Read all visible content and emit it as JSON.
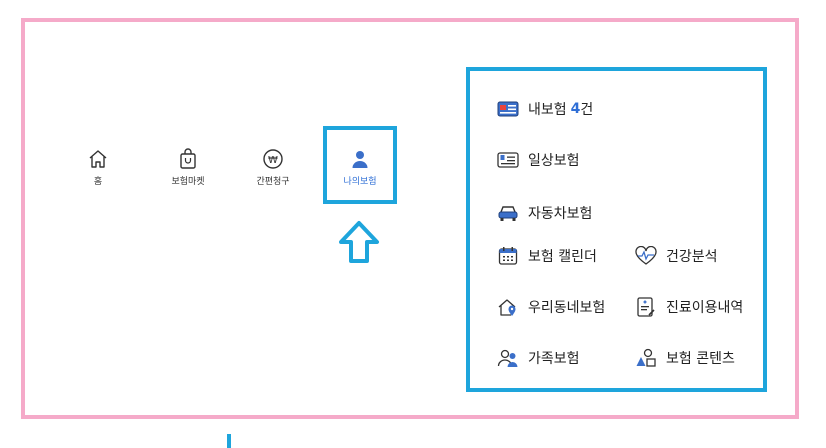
{
  "nav": {
    "items": [
      {
        "label": "홈",
        "icon": "home-icon"
      },
      {
        "label": "보험마켓",
        "icon": "shopping-bag-icon"
      },
      {
        "label": "간편청구",
        "icon": "won-coin-icon"
      },
      {
        "label": "나의보험",
        "icon": "user-icon",
        "active": true
      }
    ]
  },
  "menu": {
    "my_insurance_label": "내보험",
    "my_insurance_count": "4",
    "my_insurance_suffix": "건",
    "daily_insurance": "일상보험",
    "car_insurance": "자동차보험",
    "calendar": "보험 캘린더",
    "health_analysis": "건강분석",
    "neighborhood_insurance": "우리동네보험",
    "medical_history": "진료이용내역",
    "family_insurance": "가족보험",
    "contents": "보험 콘텐츠"
  },
  "colors": {
    "pink_border": "#f5aac9",
    "blue_highlight": "#1ea5dc",
    "active_blue": "#2f6fd6"
  }
}
